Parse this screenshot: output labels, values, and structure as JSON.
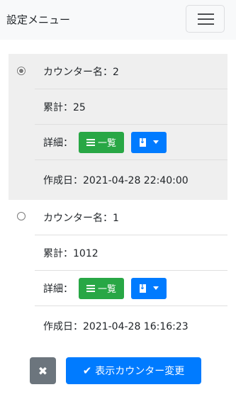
{
  "navbar": {
    "title": "設定メニュー",
    "menu_icon": "hamburger-icon"
  },
  "counters": [
    {
      "selected": true,
      "name": "カウンター名：2",
      "total": "累計：25",
      "detail_label": "詳細：",
      "list_button": "一覧",
      "created": "作成日：2021-04-28 22:40:00"
    },
    {
      "selected": false,
      "name": "カウンター名：1",
      "total": "累計：1012",
      "detail_label": "詳細：",
      "list_button": "一覧",
      "created": "作成日：2021-04-28 16:16:23"
    }
  ],
  "footer": {
    "close_icon": "✖",
    "apply_icon": "✔",
    "apply_label": "表示カウンター変更"
  },
  "colors": {
    "green": "#28a745",
    "blue": "#007bff",
    "gray": "#6c757d",
    "selected_bg": "#efefef"
  }
}
